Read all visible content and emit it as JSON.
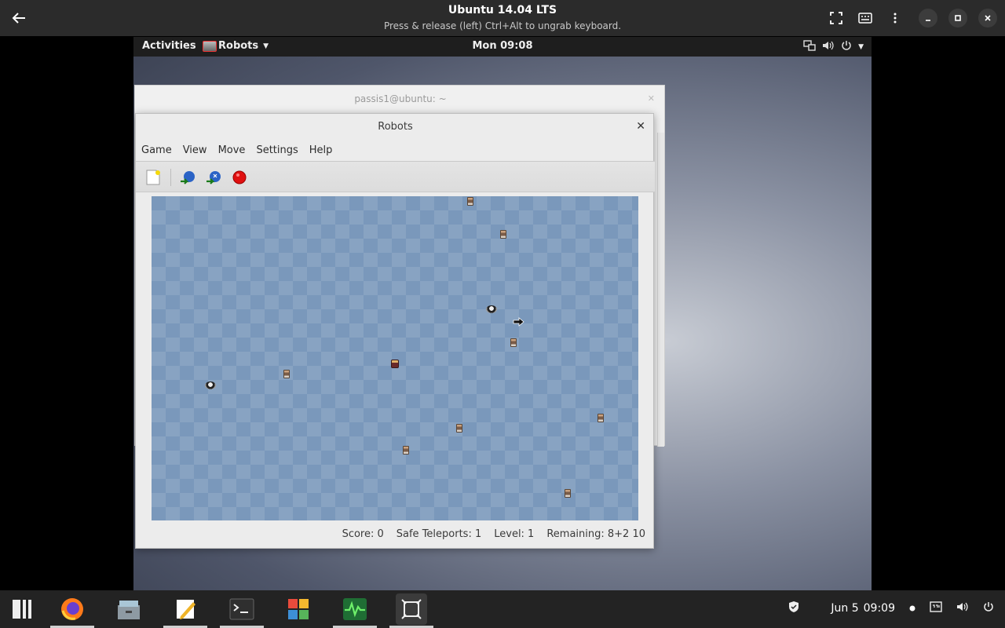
{
  "host": {
    "title": "Ubuntu 14.04 LTS",
    "subtitle": "Press & release (left) Ctrl+Alt to ungrab keyboard."
  },
  "guest_topbar": {
    "activities": "Activities",
    "app_name": "Robots",
    "clock": "Mon 09:08"
  },
  "terminal_window": {
    "title": "passis1@ubuntu: ~"
  },
  "robots_window": {
    "title": "Robots",
    "menu": [
      "Game",
      "View",
      "Move",
      "Settings",
      "Help"
    ],
    "status": {
      "score": "Score:  0",
      "safe_teleports": "Safe Teleports:  1",
      "level": "Level:  1",
      "remaining": "Remaining:  8+2 10"
    }
  },
  "taskbar": {
    "date": "Jun 5",
    "time": "09:09"
  },
  "colors": {
    "board": "#7a98bb",
    "host_bar": "#2b2b2b",
    "taskbar": "#232323"
  }
}
